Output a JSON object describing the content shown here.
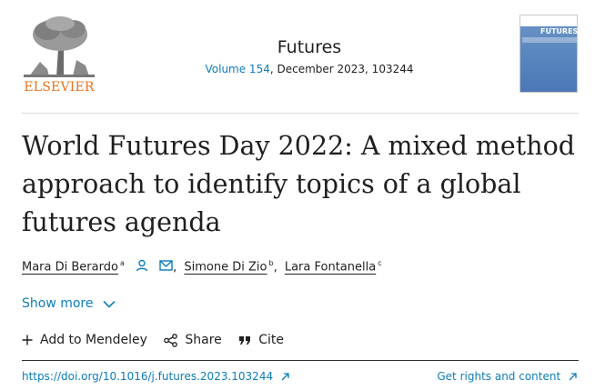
{
  "header": {
    "publisher_logo_text": "ELSEVIER",
    "journal_title": "Futures",
    "volume_link": "Volume 154",
    "issue_details": ", December 2023, 103244",
    "cover_label": "FUTURES"
  },
  "article": {
    "title": "World Futures Day 2022: A mixed method approach to identify topics of a global futures agenda",
    "authors": [
      {
        "name": "Mara Di Berardo",
        "affiliation": "a"
      },
      {
        "name": "Simone Di Zio",
        "affiliation": "b"
      },
      {
        "name": "Lara Fontanella",
        "affiliation": "c"
      }
    ],
    "separator": ","
  },
  "show_more": {
    "label": "Show more"
  },
  "actions": {
    "add_mendeley": "Add to Mendeley",
    "share": "Share",
    "cite": "Cite"
  },
  "footer_links": {
    "doi": "https://doi.org/10.1016/j.futures.2023.103244",
    "rights": "Get rights and content"
  },
  "colors": {
    "link": "#0c7dbb",
    "brand_orange": "#e9711c",
    "text": "#1f1f1f"
  },
  "icons": {
    "person": "person-icon",
    "email": "email-icon",
    "chevron": "chevron-down-icon",
    "plus": "plus-icon",
    "share": "share-icon",
    "cite": "quote-icon",
    "external": "external-link-icon"
  }
}
